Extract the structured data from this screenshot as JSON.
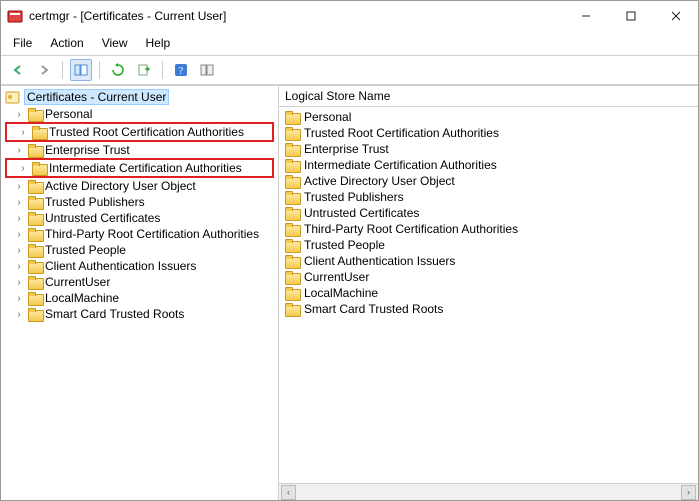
{
  "window": {
    "title": "certmgr - [Certificates - Current User]"
  },
  "menubar": [
    "File",
    "Action",
    "View",
    "Help"
  ],
  "tree": {
    "root_label": "Certificates - Current User",
    "items": [
      {
        "label": "Personal",
        "highlight": false
      },
      {
        "label": "Trusted Root Certification Authorities",
        "highlight": true
      },
      {
        "label": "Enterprise Trust",
        "highlight": false
      },
      {
        "label": "Intermediate Certification Authorities",
        "highlight": true
      },
      {
        "label": "Active Directory User Object",
        "highlight": false
      },
      {
        "label": "Trusted Publishers",
        "highlight": false
      },
      {
        "label": "Untrusted Certificates",
        "highlight": false
      },
      {
        "label": "Third-Party Root Certification Authorities",
        "highlight": false
      },
      {
        "label": "Trusted People",
        "highlight": false
      },
      {
        "label": "Client Authentication Issuers",
        "highlight": false
      },
      {
        "label": "CurrentUser",
        "highlight": false
      },
      {
        "label": "LocalMachine",
        "highlight": false
      },
      {
        "label": "Smart Card Trusted Roots",
        "highlight": false
      }
    ]
  },
  "list": {
    "header": "Logical Store Name",
    "items": [
      "Personal",
      "Trusted Root Certification Authorities",
      "Enterprise Trust",
      "Intermediate Certification Authorities",
      "Active Directory User Object",
      "Trusted Publishers",
      "Untrusted Certificates",
      "Third-Party Root Certification Authorities",
      "Trusted People",
      "Client Authentication Issuers",
      "CurrentUser",
      "LocalMachine",
      "Smart Card Trusted Roots"
    ]
  }
}
